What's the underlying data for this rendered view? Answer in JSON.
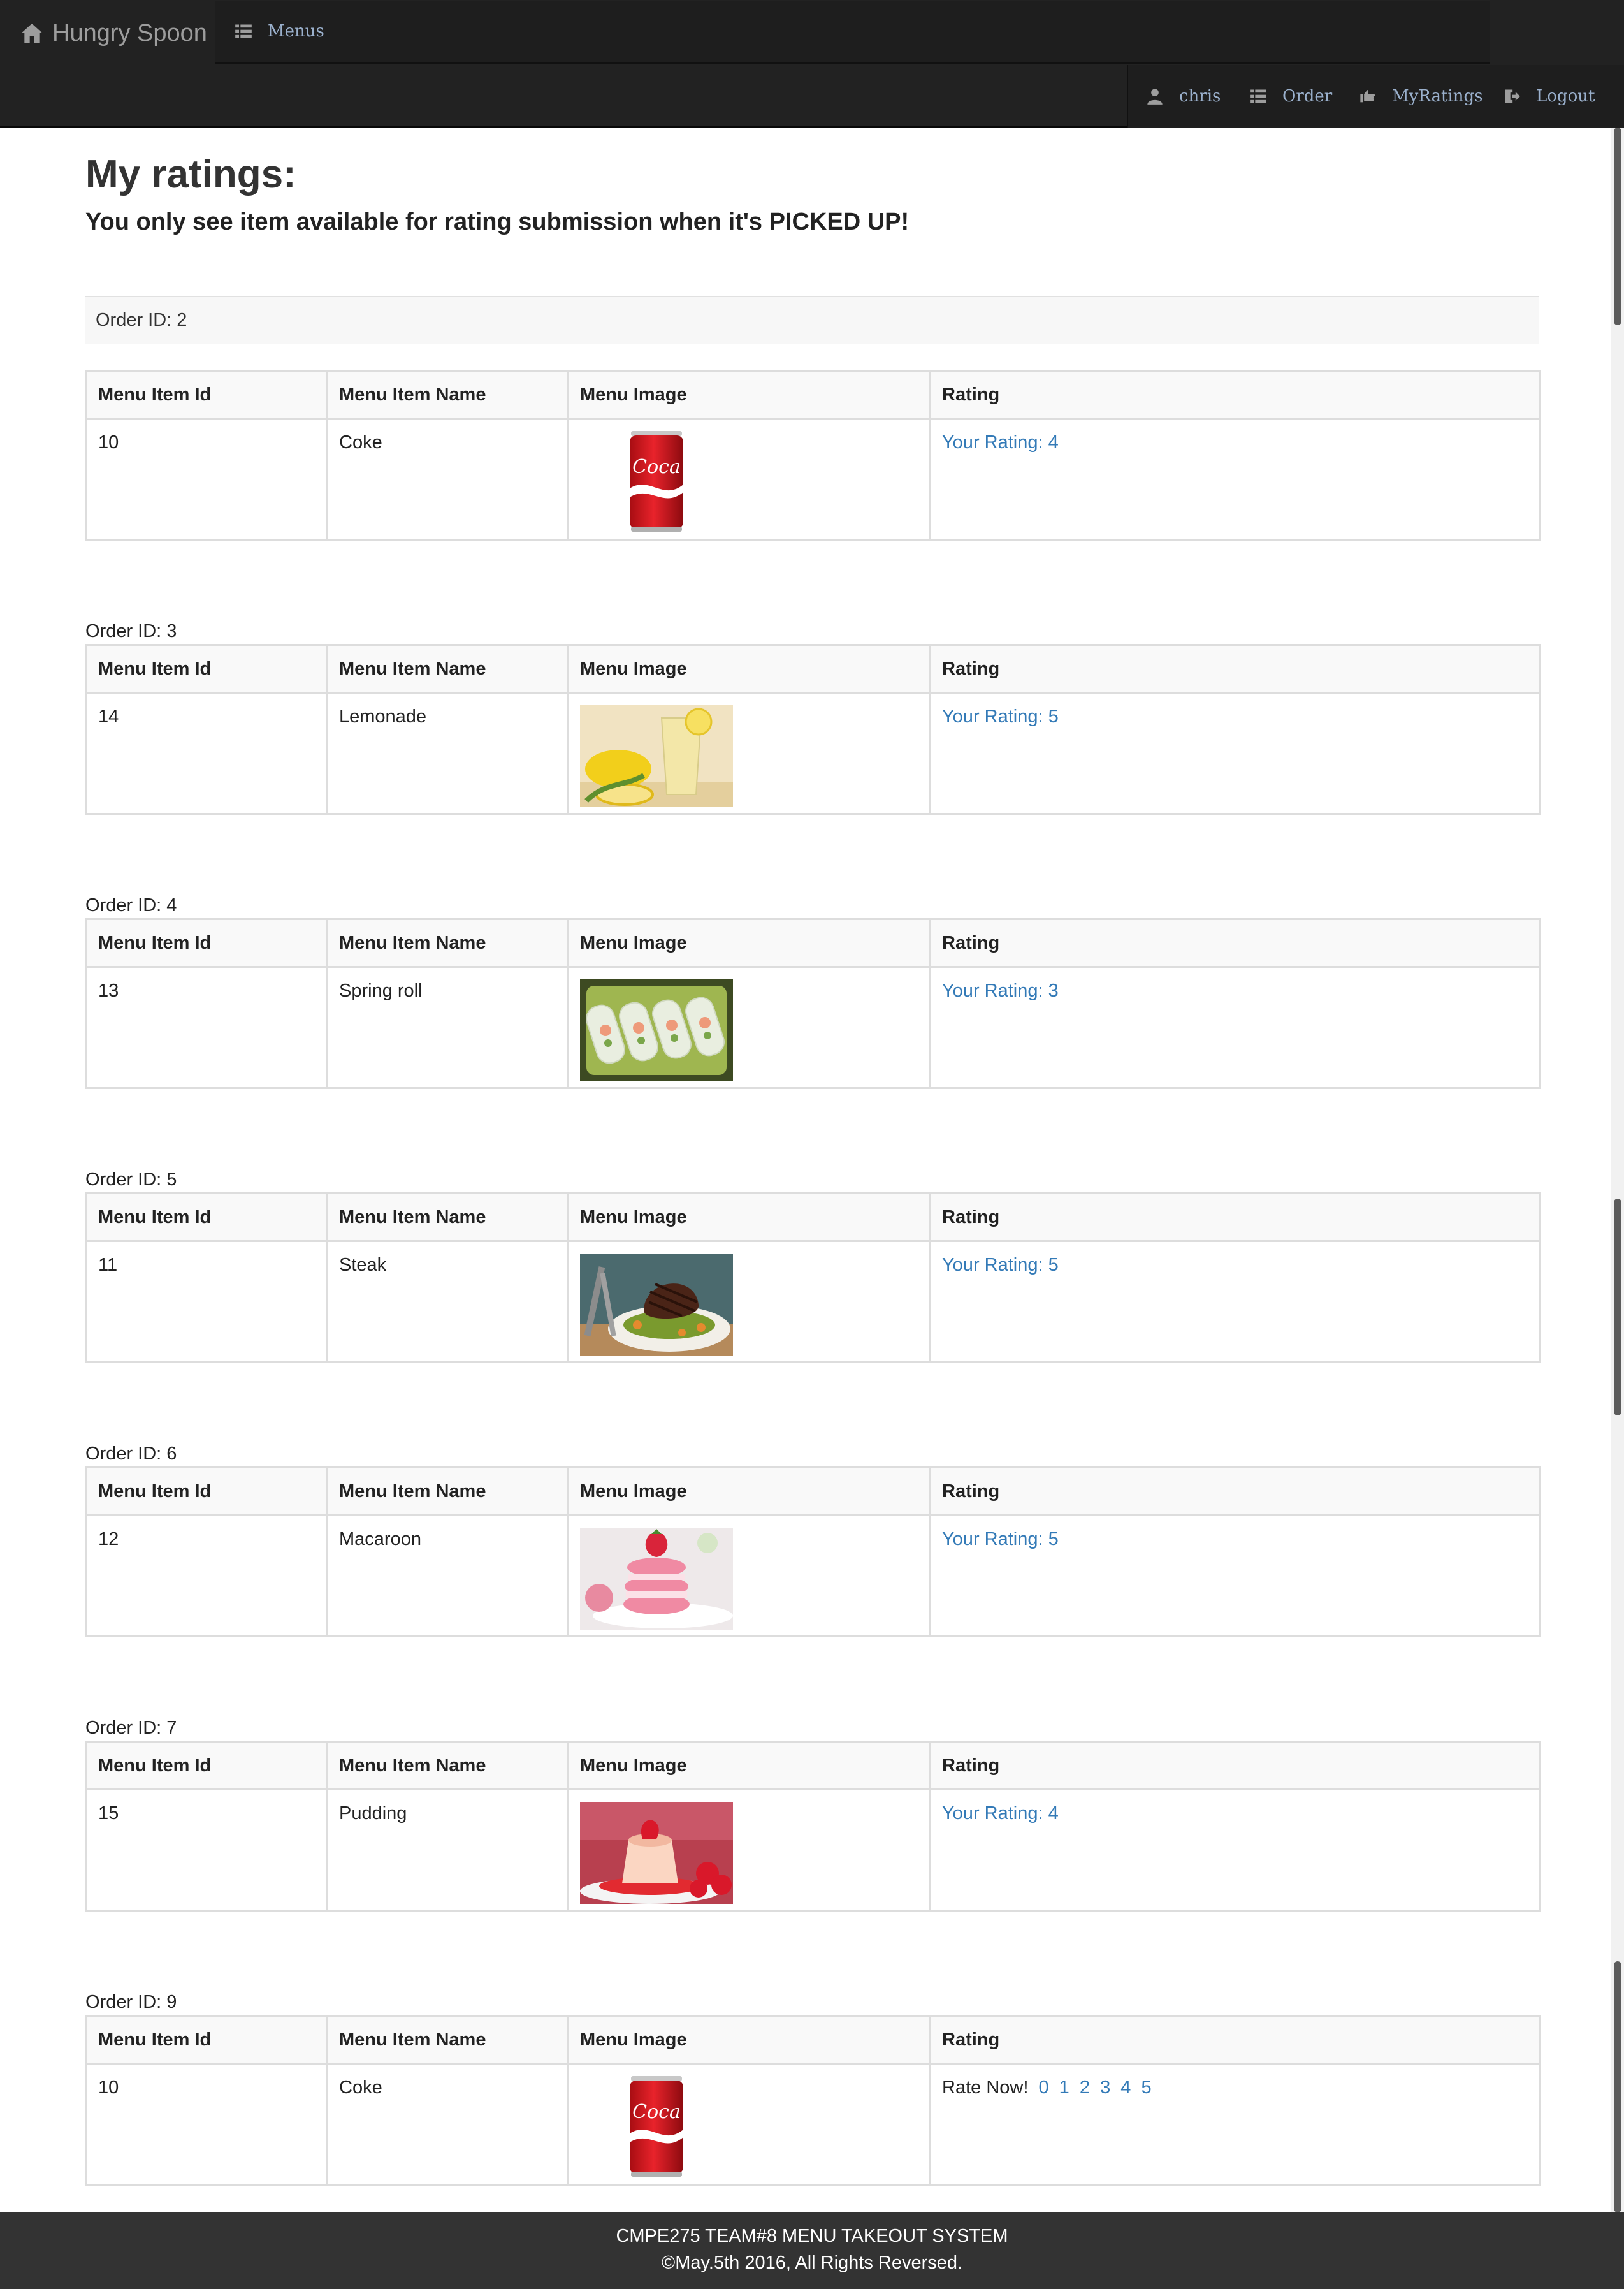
{
  "navbar": {
    "brand": "Hungry Spoon",
    "menus_label": "Menus",
    "user_label": "chris",
    "order_label": "Order",
    "myratings_label": "MyRatings",
    "logout_label": "Logout"
  },
  "page": {
    "title": "My ratings:",
    "subtitle": "You only see item available for rating submission when it's PICKED UP!"
  },
  "table_headers": {
    "id": "Menu Item Id",
    "name": "Menu Item Name",
    "image": "Menu Image",
    "rating": "Rating"
  },
  "orders": [
    {
      "order_label": "Order ID: 2",
      "item_id": "10",
      "item_name": "Coke",
      "image": "coke-can-image",
      "rating_text": "Your Rating: 4"
    },
    {
      "order_label": "Order ID: 3",
      "item_id": "14",
      "item_name": "Lemonade",
      "image": "lemonade-image",
      "rating_text": "Your Rating: 5"
    },
    {
      "order_label": "Order ID: 4",
      "item_id": "13",
      "item_name": "Spring roll",
      "image": "spring-roll-image",
      "rating_text": "Your Rating: 3"
    },
    {
      "order_label": "Order ID: 5",
      "item_id": "11",
      "item_name": "Steak",
      "image": "steak-image",
      "rating_text": "Your Rating: 5"
    },
    {
      "order_label": "Order ID: 6",
      "item_id": "12",
      "item_name": "Macaroon",
      "image": "macaroon-image",
      "rating_text": "Your Rating: 5"
    },
    {
      "order_label": "Order ID: 7",
      "item_id": "15",
      "item_name": "Pudding",
      "image": "pudding-image",
      "rating_text": "Your Rating: 4"
    },
    {
      "order_label": "Order ID: 9",
      "item_id": "10",
      "item_name": "Coke",
      "image": "coke-can-image",
      "rate_now_label": "Rate Now!",
      "rate_options": [
        "0",
        "1",
        "2",
        "3",
        "4",
        "5"
      ]
    }
  ],
  "footer": {
    "line1": "CMPE275 TEAM#8 MENU TAKEOUT SYSTEM",
    "line2": "©May.5th 2016, All Rights Reversed."
  },
  "colors": {
    "navbar_bg": "#222222",
    "link_blue": "#337ab7",
    "footer_bg": "#333333"
  }
}
